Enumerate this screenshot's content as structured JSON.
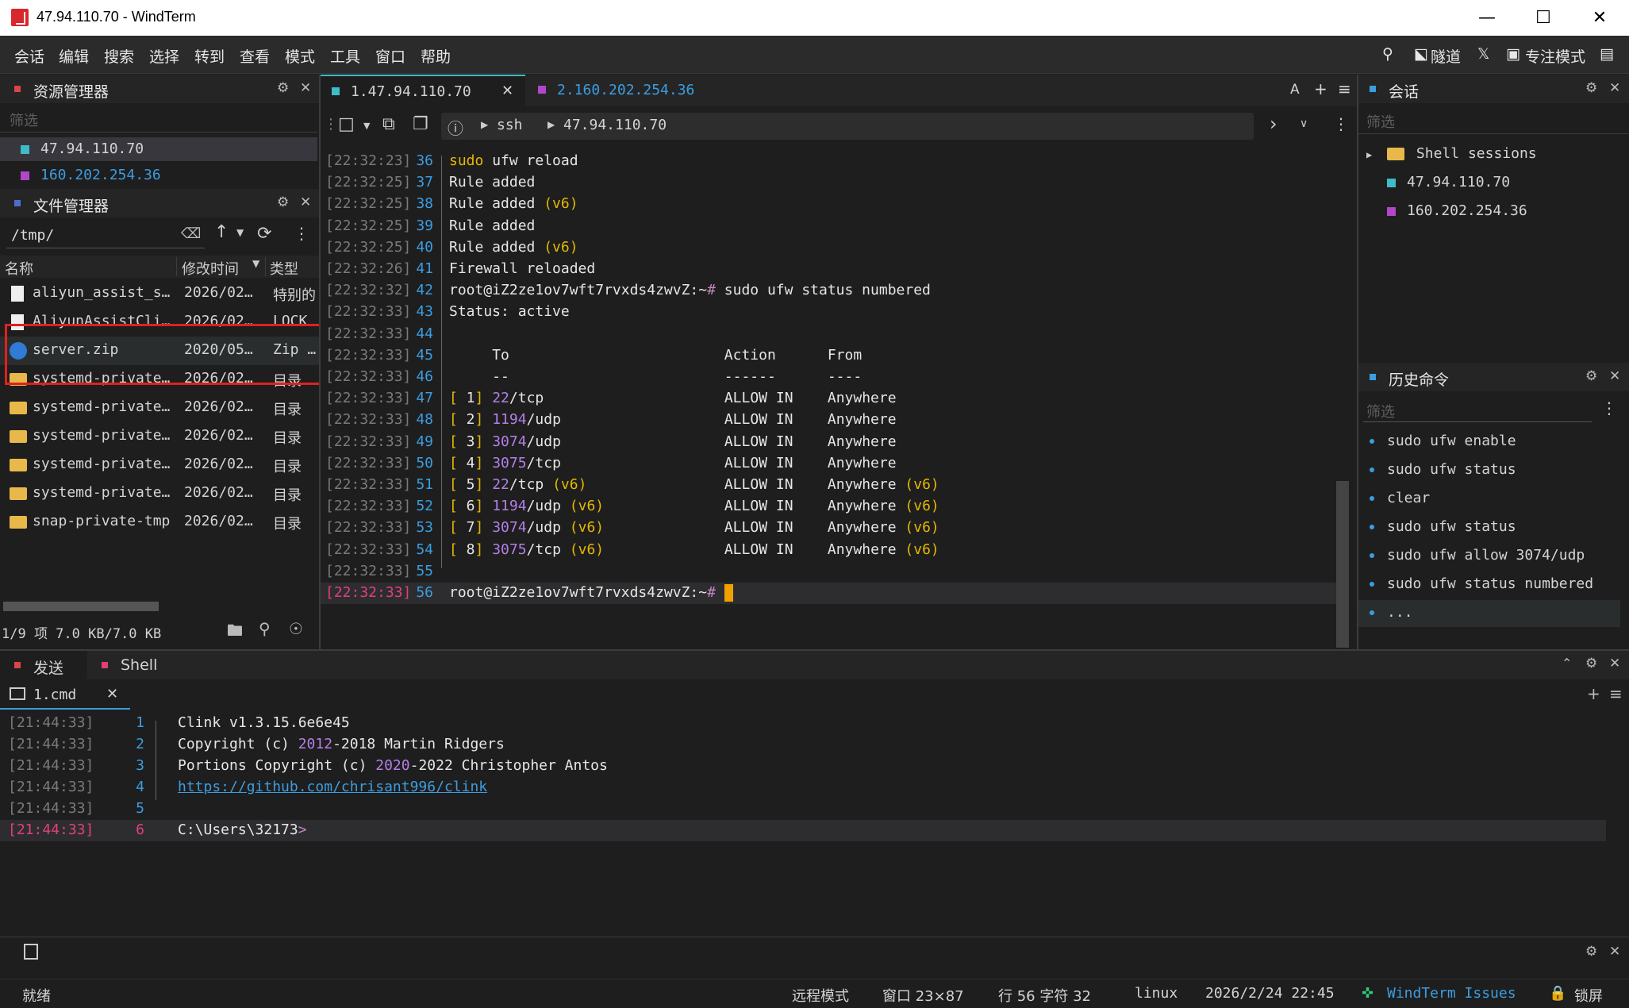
{
  "window": {
    "title": "47.94.110.70 - WindTerm"
  },
  "menu": {
    "items": [
      "会话",
      "编辑",
      "搜索",
      "选择",
      "转到",
      "查看",
      "模式",
      "工具",
      "窗口",
      "帮助"
    ],
    "right": {
      "tunnel": "隧道",
      "focus": "专注模式"
    }
  },
  "explorer": {
    "title": "资源管理器",
    "filter": "筛选",
    "hosts": [
      "47.94.110.70",
      "160.202.254.36"
    ]
  },
  "files": {
    "title": "文件管理器",
    "path": "/tmp/",
    "columns": [
      "名称",
      "修改时间",
      "类型"
    ],
    "rows": [
      {
        "name": "aliyun_assist_s…",
        "date": "2026/02…",
        "type": "特别的"
      },
      {
        "name": "AliyunAssistCli…",
        "date": "2026/02…",
        "type": "LOCK"
      },
      {
        "name": "server.zip",
        "date": "2020/05…",
        "type": "Zip …"
      },
      {
        "name": "systemd-private…",
        "date": "2026/02…",
        "type": "目录"
      },
      {
        "name": "systemd-private…",
        "date": "2026/02…",
        "type": "目录"
      },
      {
        "name": "systemd-private…",
        "date": "2026/02…",
        "type": "目录"
      },
      {
        "name": "systemd-private…",
        "date": "2026/02…",
        "type": "目录"
      },
      {
        "name": "systemd-private…",
        "date": "2026/02…",
        "type": "目录"
      },
      {
        "name": "snap-private-tmp",
        "date": "2026/02…",
        "type": "目录"
      }
    ],
    "status": "1/9 项 7.0 KB/7.0 KB"
  },
  "tabs": [
    {
      "label": "1.47.94.110.70",
      "color": "#3ebcc8"
    },
    {
      "label": "2.160.202.254.36",
      "color": "#b047c9"
    }
  ],
  "breadcrumb": {
    "protocol": "ssh",
    "host": "47.94.110.70"
  },
  "terminal": {
    "lines": [
      {
        "ts": "[22:32:23]",
        "n": "36",
        "text": "sudo ufw reload"
      },
      {
        "ts": "[22:32:25]",
        "n": "37",
        "text": "Rule added"
      },
      {
        "ts": "[22:32:25]",
        "n": "38",
        "text": "Rule added (v6)"
      },
      {
        "ts": "[22:32:25]",
        "n": "39",
        "text": "Rule added"
      },
      {
        "ts": "[22:32:25]",
        "n": "40",
        "text": "Rule added (v6)"
      },
      {
        "ts": "[22:32:26]",
        "n": "41",
        "text": "Firewall reloaded"
      },
      {
        "ts": "[22:32:32]",
        "n": "42",
        "text": "root@iZ2ze1ov7wft7rvxds4zwvZ:~# sudo ufw status numbered"
      },
      {
        "ts": "[22:32:33]",
        "n": "43",
        "text": "Status: active"
      },
      {
        "ts": "[22:32:33]",
        "n": "44",
        "text": ""
      },
      {
        "ts": "[22:32:33]",
        "n": "45",
        "text": "     To                         Action      From"
      },
      {
        "ts": "[22:32:33]",
        "n": "46",
        "text": "     --                         ------      ----"
      },
      {
        "ts": "[22:32:33]",
        "n": "47",
        "text": "[ 1] 22/tcp                     ALLOW IN    Anywhere"
      },
      {
        "ts": "[22:32:33]",
        "n": "48",
        "text": "[ 2] 1194/udp                   ALLOW IN    Anywhere"
      },
      {
        "ts": "[22:32:33]",
        "n": "49",
        "text": "[ 3] 3074/udp                   ALLOW IN    Anywhere"
      },
      {
        "ts": "[22:32:33]",
        "n": "50",
        "text": "[ 4] 3075/tcp                   ALLOW IN    Anywhere"
      },
      {
        "ts": "[22:32:33]",
        "n": "51",
        "text": "[ 5] 22/tcp (v6)                ALLOW IN    Anywhere (v6)"
      },
      {
        "ts": "[22:32:33]",
        "n": "52",
        "text": "[ 6] 1194/udp (v6)              ALLOW IN    Anywhere (v6)"
      },
      {
        "ts": "[22:32:33]",
        "n": "53",
        "text": "[ 7] 3074/udp (v6)              ALLOW IN    Anywhere (v6)"
      },
      {
        "ts": "[22:32:33]",
        "n": "54",
        "text": "[ 8] 3075/tcp (v6)              ALLOW IN    Anywhere (v6)"
      },
      {
        "ts": "[22:32:33]",
        "n": "55",
        "text": ""
      },
      {
        "ts": "[22:32:33]",
        "n": "56",
        "text": "root@iZ2ze1ov7wft7rvxds4zwvZ:~# "
      }
    ]
  },
  "sessions": {
    "title": "会话",
    "filter": "筛选",
    "folder": "Shell sessions",
    "items": [
      "47.94.110.70",
      "160.202.254.36"
    ]
  },
  "history": {
    "title": "历史命令",
    "filter": "筛选",
    "items": [
      "sudo ufw enable",
      "sudo ufw status",
      "clear",
      "sudo ufw status",
      "sudo ufw allow 3074/udp",
      "sudo ufw status numbered",
      "..."
    ]
  },
  "bottom": {
    "tabs": [
      "发送",
      "Shell"
    ],
    "subtab": "1.cmd",
    "lines": [
      {
        "ts": "[21:44:33]",
        "n": "1",
        "text": "Clink v1.3.15.6e6e45"
      },
      {
        "ts": "[21:44:33]",
        "n": "2",
        "text": "Copyright (c) 2012-2018 Martin Ridgers"
      },
      {
        "ts": "[21:44:33]",
        "n": "3",
        "text": "Portions Copyright (c) 2020-2022 Christopher Antos"
      },
      {
        "ts": "[21:44:33]",
        "n": "4",
        "text": "https://github.com/chrisant996/clink"
      },
      {
        "ts": "[21:44:33]",
        "n": "5",
        "text": ""
      },
      {
        "ts": "[21:44:33]",
        "n": "6",
        "text": "C:\\Users\\32173>"
      }
    ]
  },
  "statusbar": {
    "ready": "就绪",
    "mode": "远程模式",
    "window": "窗口 23×87",
    "pos": "行 56 字符 32",
    "os": "linux",
    "datetime": "2026/2/24 22:45",
    "issues": "WindTerm Issues",
    "lock": "锁屏"
  }
}
